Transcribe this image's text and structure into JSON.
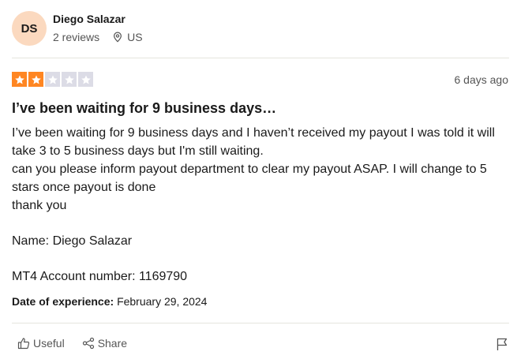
{
  "reviewer": {
    "initials": "DS",
    "name": "Diego Salazar",
    "reviews_count": "2 reviews",
    "location": "US",
    "avatar_color": "#fbd9bf"
  },
  "rating": {
    "value": 2,
    "max": 5,
    "filled_color": "#ff8622",
    "empty_color": "#dcdce6"
  },
  "review": {
    "date_posted": "6 days ago",
    "title": "I’ve been waiting for 9 business days…",
    "lines": [
      "I’ve been waiting for 9 business days and I haven’t received my payout I was told it will take 3 to 5 business days but I'm still waiting.",
      "can you please inform payout department to clear my payout ASAP. I will change to 5 stars once payout is done",
      "thank you",
      "",
      "Name: Diego Salazar",
      "",
      "MT4 Account number: 1169790"
    ],
    "experience_label": "Date of experience:",
    "experience_date": "February 29, 2024"
  },
  "actions": {
    "useful_label": "Useful",
    "share_label": "Share",
    "useful_icon": "thumbs-up-icon",
    "share_icon": "share-icon",
    "report_icon": "flag-icon"
  }
}
